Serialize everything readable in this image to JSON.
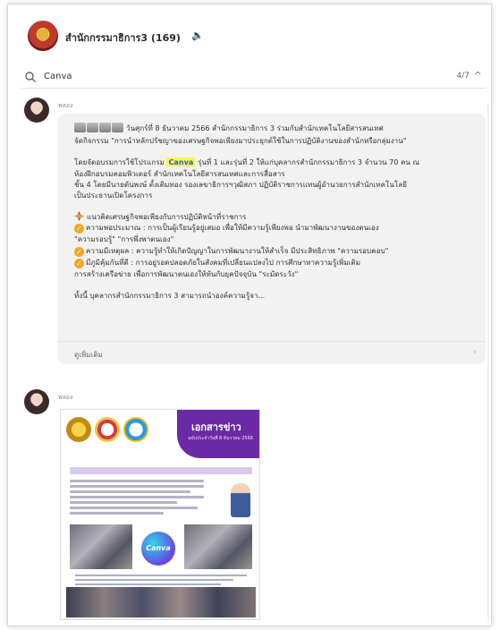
{
  "header": {
    "group_name": "สำนักกรรมาธิการ3 (169)",
    "speaker_icon": "speaker-icon"
  },
  "search": {
    "query": "Canva",
    "match_count": "4/7"
  },
  "message1": {
    "sender": "พลอง",
    "line1": "วันศุกร์ที่ 8 ธันวาคม 2566 สำนักกรรมาธิการ 3 ร่วมกับสำนักเทคโนโลยีสารสนเทศ",
    "line2": "จัดกิจกรรม \"การนำหลักปรัชญาของเศรษฐกิจพอเพียงมาประยุกต์ใช้ในการปฏิบัติงานของสำนักหรือกลุ่มงาน\"",
    "line3a": "โดยจัดอบรมการใช้โปรแกรม",
    "highlight": "Canva",
    "line3b": "รุ่นที่ 1 และรุ่นที่ 2 ให้แก่บุคลากรสำนักกรรมาธิการ 3 จำนวน 70 คน ณ",
    "line4": "ห้องฝึกอบรมคอมพิวเตอร์ สำนักเทคโนโลยีสารสนเทศและการสื่อสาร",
    "line5": "ชั้น 4 โดยมีนายตันพงษ์ ตั้งเติมทอง รองเลขาธิการฯวุฒิสภา ปฏิบัติราชการแทนผู้อำนวยการสำนักเทคโนโลยี",
    "line6": "เป็นประธานเปิดโครงการ",
    "line7": "แนวคิดเศรษฐกิจพอเพียงกับการปฏิบัติหน้าที่ราชการ",
    "line8": "ความพอประมาณ : การเป็นผู้เรียนรู้อยู่เสมอ เพื่อให้มีความรู้เพียงพอ นำมาพัฒนางานของตนเอง",
    "line9": "\"ความรอบรู้\" \"การพึ่งพาตนเอง\"",
    "line10": "ความมีเหตุผล : ความรู้ทำให้เกิดปัญญาในการพัฒนางานให้สำเร็จ มีประสิทธิภาพ \"ความรอบคอบ\"",
    "line11": "มีภูมิคุ้มกันที่ดี : การอยู่รอดปลอดภัยในสังคมที่เปลี่ยนแปลงไป การศึกษาหาความรู้เพิ่มเติม",
    "line12": "การสร้างเครือข่าย เพื่อการพัฒนาตนเองให้ทันกับยุคปัจจุบัน \"ระมัดระวัง\"",
    "line13": "ทั้งนี้ บุคลากรสำนักกรรมาธิการ 3 สามารถนำองค์ความรู้จา...",
    "read_more": "ดูเพิ่มเติม"
  },
  "message2": {
    "sender": "พลอง",
    "poster": {
      "banner_title": "เอกสารข่าว",
      "banner_sub": "ฉบับประจำวันที่ 8 ธันวาคม 2566",
      "canva_label": "Canva"
    }
  }
}
